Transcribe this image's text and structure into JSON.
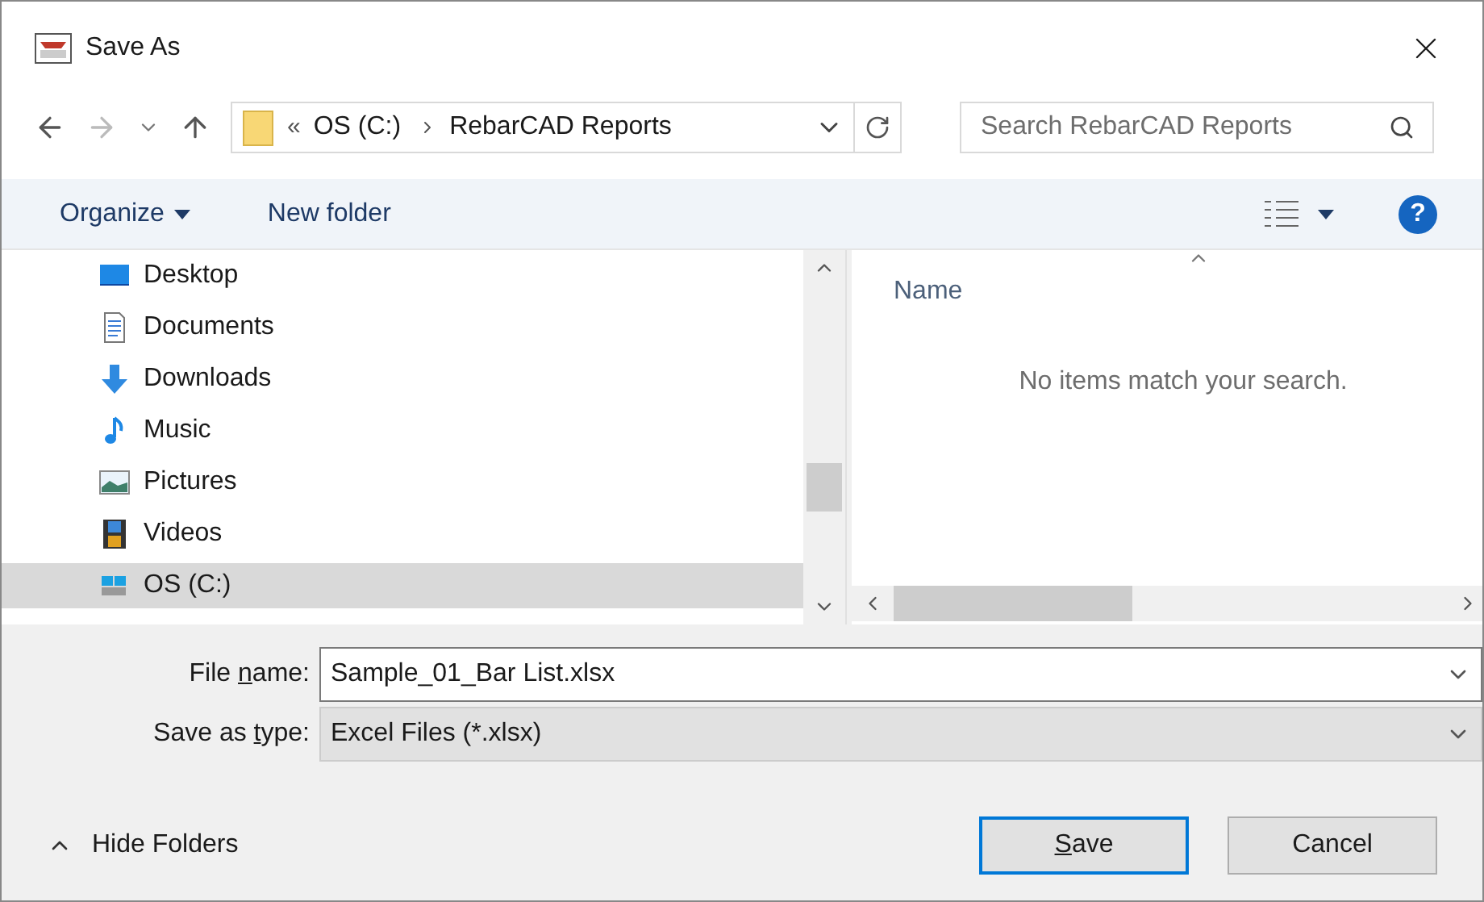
{
  "window": {
    "title": "Save As"
  },
  "address": {
    "prefix": "«",
    "crumbs": [
      "OS (C:)",
      "RebarCAD Reports"
    ]
  },
  "search": {
    "placeholder": "Search RebarCAD Reports"
  },
  "toolbar": {
    "organize": "Organize",
    "new_folder": "New folder",
    "help": "?"
  },
  "sidebar": {
    "items": [
      {
        "label": "Desktop",
        "kind": "desktop",
        "selected": false
      },
      {
        "label": "Documents",
        "kind": "documents",
        "selected": false
      },
      {
        "label": "Downloads",
        "kind": "downloads",
        "selected": false
      },
      {
        "label": "Music",
        "kind": "music",
        "selected": false
      },
      {
        "label": "Pictures",
        "kind": "pictures",
        "selected": false
      },
      {
        "label": "Videos",
        "kind": "videos",
        "selected": false
      },
      {
        "label": "OS (C:)",
        "kind": "drive",
        "selected": true
      }
    ]
  },
  "file_list": {
    "column": "Name",
    "empty_message": "No items match your search."
  },
  "fields": [
    {
      "label": {
        "before": "File ",
        "key": "n",
        "after": "ame:"
      },
      "value": "Sample_01_Bar List.xlsx",
      "kind": "combo"
    },
    {
      "label": {
        "before": "Save as ",
        "key": "t",
        "after": "ype:"
      },
      "value": "Excel Files (*.xlsx)",
      "kind": "select"
    }
  ],
  "hide_folders": "Hide Folders",
  "buttons": [
    {
      "label": {
        "key": "S",
        "after": "ave"
      },
      "default": true
    },
    {
      "label": {
        "before": "Cancel"
      },
      "default": false
    }
  ]
}
